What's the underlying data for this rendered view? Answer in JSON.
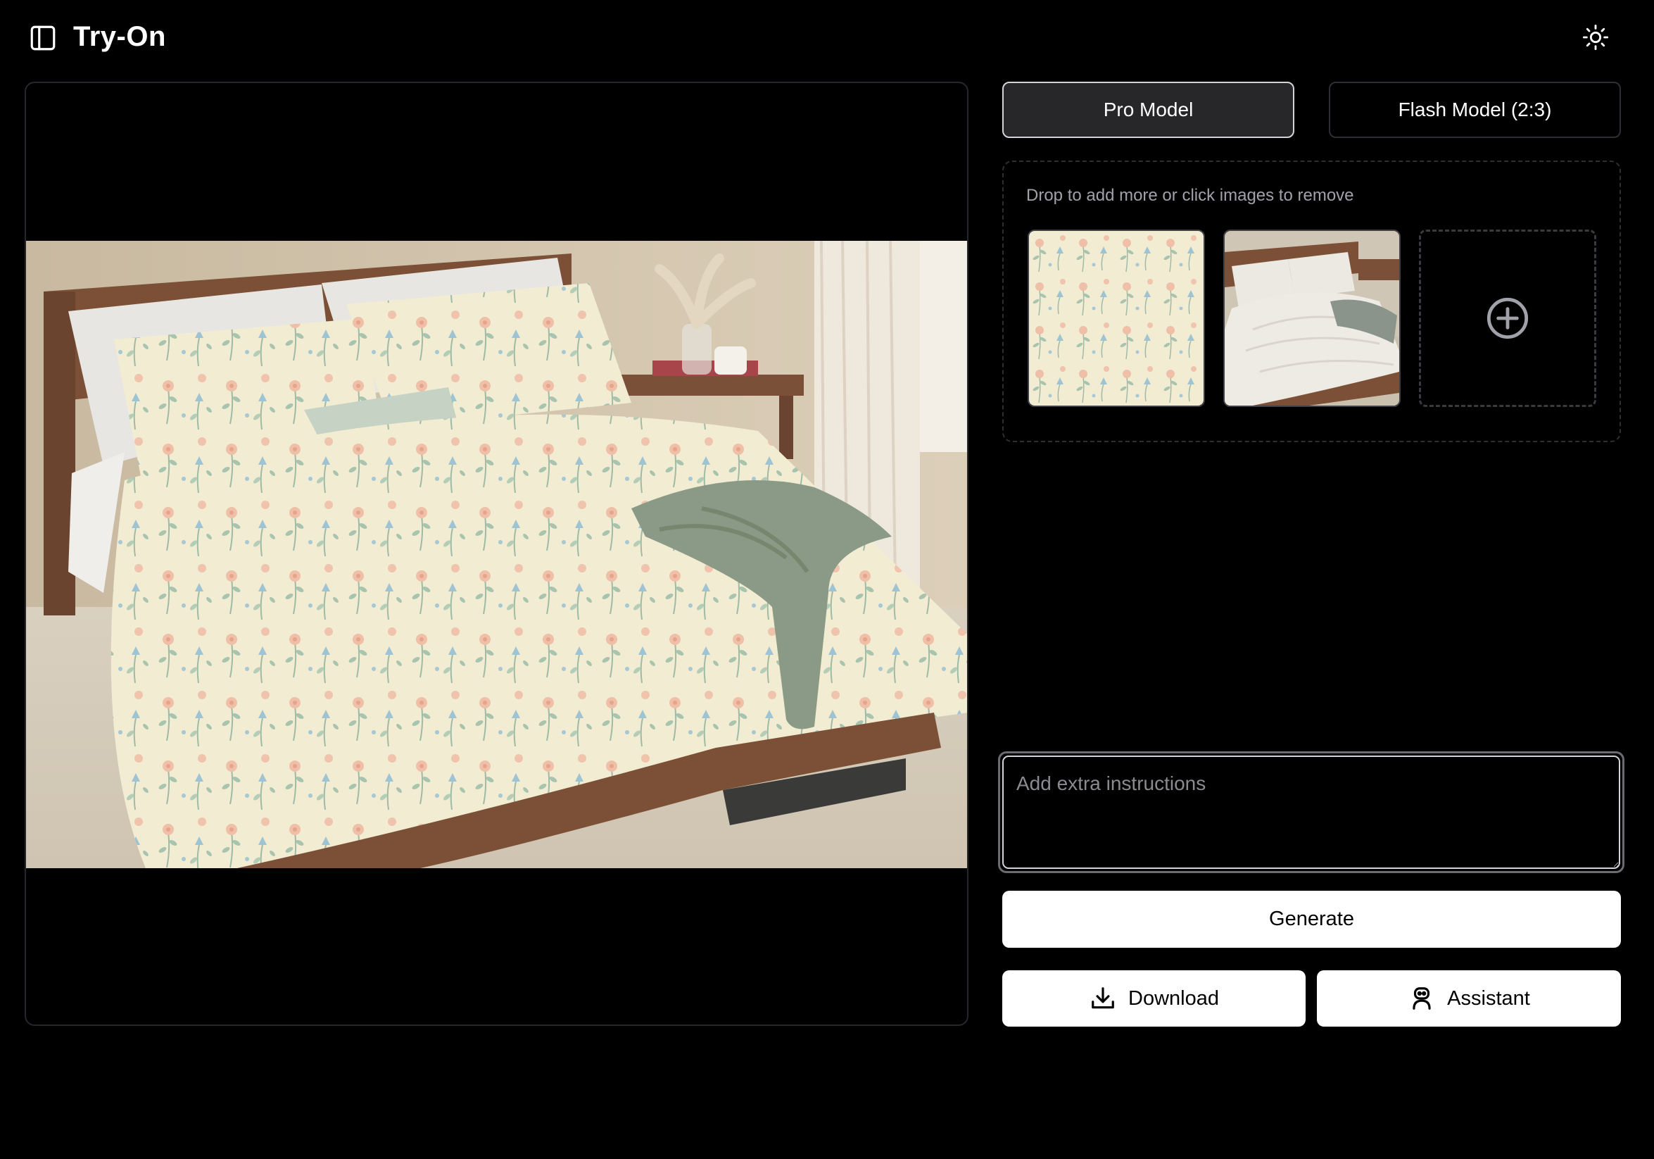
{
  "header": {
    "title": "Try-On",
    "sidebar_icon": "sidebar-panel-icon",
    "theme_icon": "sun-icon"
  },
  "models": {
    "pro_label": "Pro Model",
    "flash_label": "Flash Model (2:3)",
    "selected": "Pro Model"
  },
  "dropzone": {
    "hint": "Drop to add more or click images to remove",
    "add_icon": "plus-circle-icon"
  },
  "instructions": {
    "placeholder": "Add extra instructions",
    "value": ""
  },
  "actions": {
    "generate_label": "Generate",
    "download_label": "Download",
    "download_icon": "download-icon",
    "assistant_label": "Assistant",
    "assistant_icon": "bot-icon"
  },
  "colors": {
    "background": "#000000",
    "panel_border": "#26272b",
    "selected_model_bg": "#27272a",
    "button_bg": "#ffffff",
    "muted_text": "#a1a1aa"
  }
}
